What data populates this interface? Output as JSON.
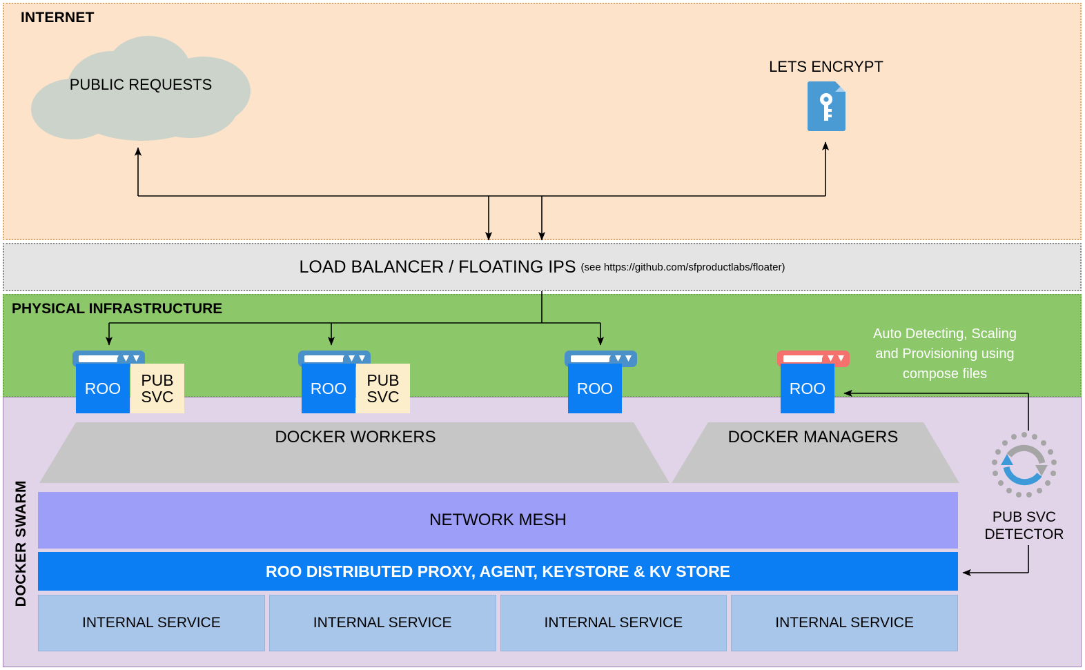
{
  "internet": {
    "label": "INTERNET",
    "cloud": {
      "label": "PUBLIC REQUESTS",
      "icon": "cloud-icon",
      "color": "#ccd3cb"
    },
    "lets_encrypt": {
      "label": "LETS ENCRYPT",
      "icon": "certificate-key-document-icon",
      "color": "#4a9ad4"
    }
  },
  "load_balancer": {
    "title": "LOAD BALANCER / FLOATING IPS",
    "subtitle": "(see https://github.com/sfproductlabs/floater)"
  },
  "physical": {
    "label": "PHYSICAL INFRASTRUCTURE",
    "note": "Auto Detecting, Scaling and Provisioning using compose files",
    "note_lines": [
      "Auto Detecting, Scaling",
      "and Provisioning using",
      "compose files"
    ],
    "servers": [
      {
        "roo": "ROO",
        "pub_line1": "PUB",
        "pub_line2": "SVC",
        "has_pub": true,
        "top_color": "#4a90c9",
        "icon": "server-icon"
      },
      {
        "roo": "ROO",
        "pub_line1": "PUB",
        "pub_line2": "SVC",
        "has_pub": true,
        "top_color": "#4a90c9",
        "icon": "server-icon"
      },
      {
        "roo": "ROO",
        "pub_line1": "",
        "pub_line2": "",
        "has_pub": false,
        "top_color": "#4a90c9",
        "icon": "server-icon"
      },
      {
        "roo": "ROO",
        "pub_line1": "",
        "pub_line2": "",
        "has_pub": false,
        "top_color": "#f4716e",
        "icon": "server-icon-alert"
      }
    ]
  },
  "swarm": {
    "label": "DOCKER SWARM",
    "workers_label": "DOCKER WORKERS",
    "managers_label": "DOCKER MANAGERS",
    "mesh_label": "NETWORK MESH",
    "proxy_label": "ROO DISTRIBUTED PROXY, AGENT, KEYSTORE & KV STORE",
    "internal_services": [
      "INTERNAL SERVICE",
      "INTERNAL SERVICE",
      "INTERNAL SERVICE",
      "INTERNAL SERVICE"
    ]
  },
  "detector": {
    "label_line1": "PUB SVC",
    "label_line2": "DETECTOR",
    "icon": "sync-refresh-icon",
    "colors": {
      "arrow_blue": "#3d9ad8",
      "arrow_gray": "#a5a5a5"
    }
  },
  "colors": {
    "internet_bg": "#fce3c9",
    "loadbalancer_bg": "#e4e4e4",
    "physical_bg": "#8cc76a",
    "swarm_bg": "#e2d4e8",
    "trapezoid": "#c6c6c6",
    "mesh": "#9d9ef8",
    "proxy": "#0b7ef4",
    "service": "#a8c6ea",
    "pub_svc": "#fdeecb"
  }
}
